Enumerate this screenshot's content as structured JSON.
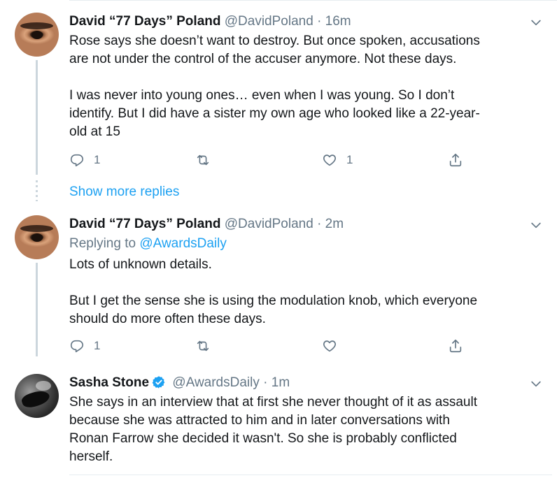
{
  "tweets": [
    {
      "name": "David “77 Days” Poland",
      "handle": "@DavidPoland",
      "dot": "·",
      "time": "16m",
      "body": [
        "Rose says she doesn’t want to destroy. But once spoken, accusations",
        "are not under the control of the accuser anymore. Not these days.",
        "",
        "I was never into young ones… even when I was young. So I don’t",
        "identify. But I did have a sister my own age who looked like a 22-year-",
        "old at 15"
      ],
      "actions": {
        "reply_count": "1",
        "retweet_count": "",
        "like_count": "1"
      }
    },
    {
      "name": "David “77 Days” Poland",
      "handle": "@DavidPoland",
      "dot": "·",
      "time": "2m",
      "replying_prefix": "Replying to",
      "replying_to": "@AwardsDaily",
      "body": [
        "Lots of unknown details.",
        "",
        "But I get the sense she is using the modulation knob, which everyone",
        "should do more often these days."
      ],
      "actions": {
        "reply_count": "1",
        "retweet_count": "",
        "like_count": ""
      }
    },
    {
      "name": "Sasha Stone",
      "handle": "@AwardsDaily",
      "dot": "·",
      "time": "1m",
      "verified": true,
      "body": [
        "She says in an interview that at first she never thought of it as assault",
        "because she was attracted to him and in later conversations with",
        "Ronan Farrow she decided it wasn't. So she is probably conflicted",
        "herself."
      ]
    }
  ],
  "show_more_replies": "Show more replies",
  "icons": {
    "reply": "reply-icon",
    "retweet": "retweet-icon",
    "like": "heart-icon",
    "share": "share-icon",
    "more": "chevron-down-icon",
    "verified": "verified-badge-icon"
  },
  "colors": {
    "link": "#1da1f2",
    "secondary_text": "#657786",
    "primary_text": "#14171a",
    "thread_line": "#ccd6dd"
  }
}
